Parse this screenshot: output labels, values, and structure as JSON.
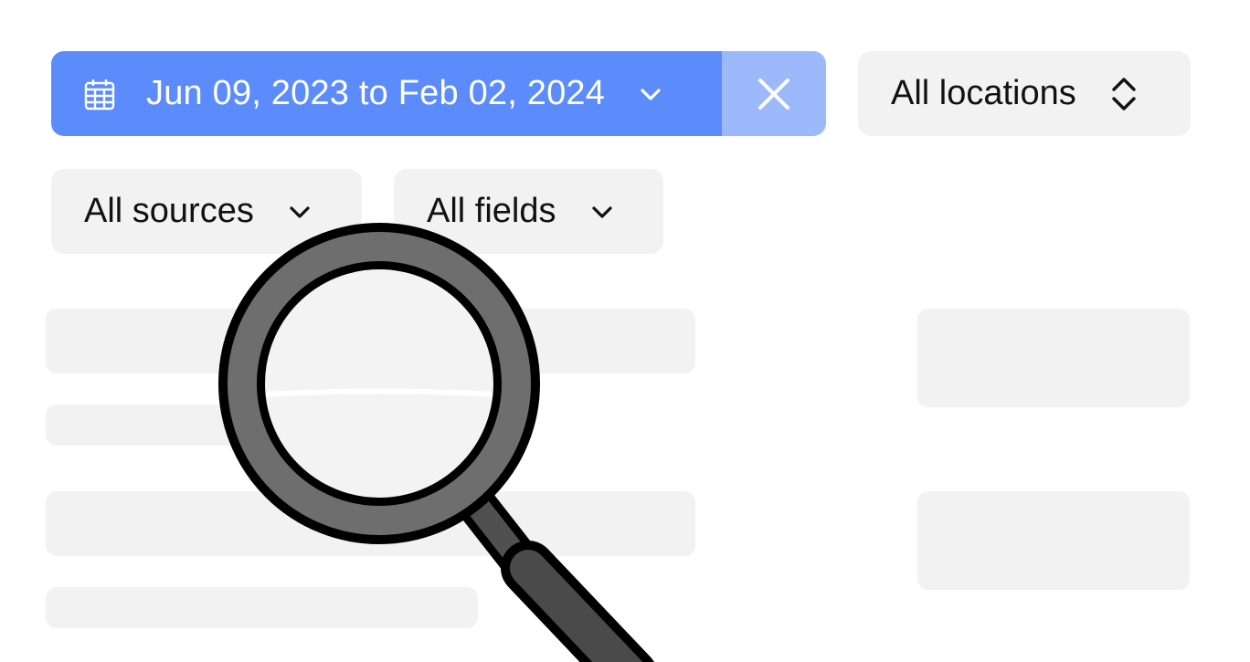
{
  "filters": {
    "date_range": {
      "label": "Jun 09, 2023 to Feb 02, 2024",
      "icon": "calendar-icon",
      "dropdown_icon": "chevron-down-icon",
      "clear_icon": "close-icon",
      "colors": {
        "primary": "#5c8cfb",
        "clear_bg": "#9cb9fb"
      }
    },
    "locations": {
      "label": "All locations",
      "icon": "chevron-up-down-icon"
    },
    "sources": {
      "label": "All sources",
      "icon": "chevron-down-icon"
    },
    "fields": {
      "label": "All fields",
      "icon": "chevron-down-icon"
    }
  },
  "illustration": {
    "icon": "magnifying-glass-icon"
  },
  "colors": {
    "pill_bg": "#f2f2f2",
    "skeleton": "#f2f2f2",
    "text": "#111111"
  }
}
